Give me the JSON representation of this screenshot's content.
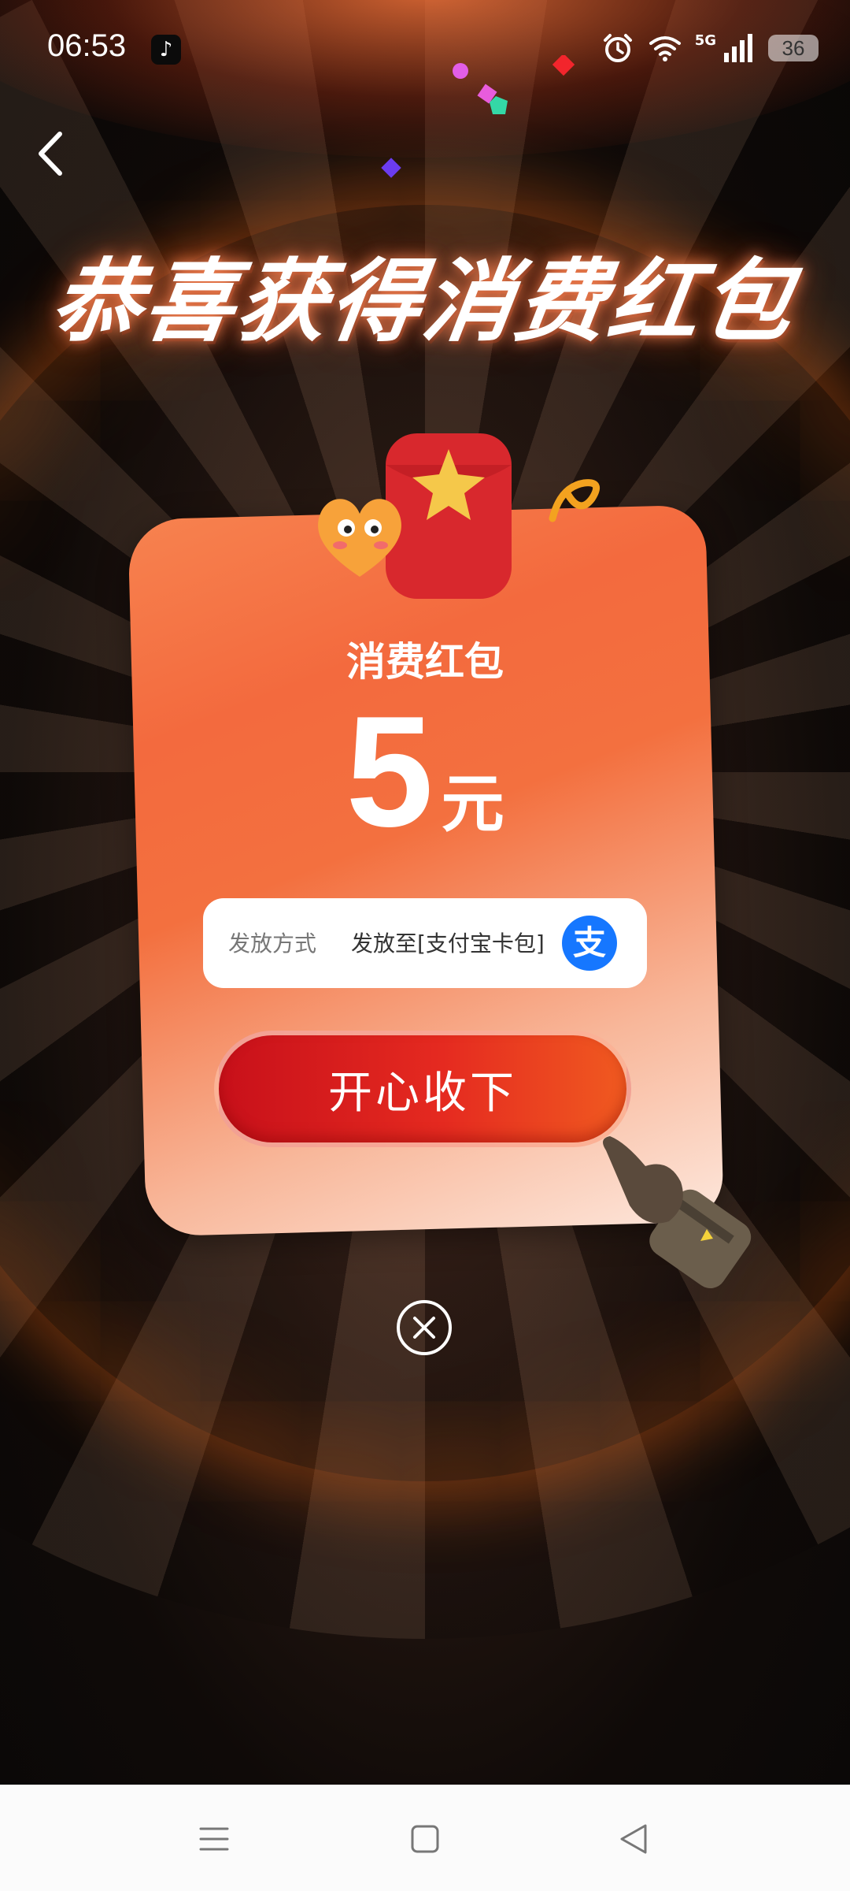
{
  "status_bar": {
    "time": "06:53",
    "network": "5G",
    "battery": "36",
    "icons": [
      "tiktok-icon",
      "alarm-icon",
      "wifi-icon",
      "signal-icon",
      "battery-icon"
    ]
  },
  "headline": "恭喜获得消费红包",
  "card": {
    "title": "消费红包",
    "amount": "5",
    "unit": "元",
    "delivery_label": "发放方式",
    "delivery_value": "发放至[支付宝卡包]",
    "alipay_glyph": "支",
    "accept_button": "开心收下"
  },
  "colors": {
    "accent": "#f36a3e",
    "button": "#e52a20",
    "alipay": "#1677ff"
  },
  "nav_bar": {
    "icons": [
      "menu-icon",
      "home-icon",
      "back-icon"
    ]
  }
}
